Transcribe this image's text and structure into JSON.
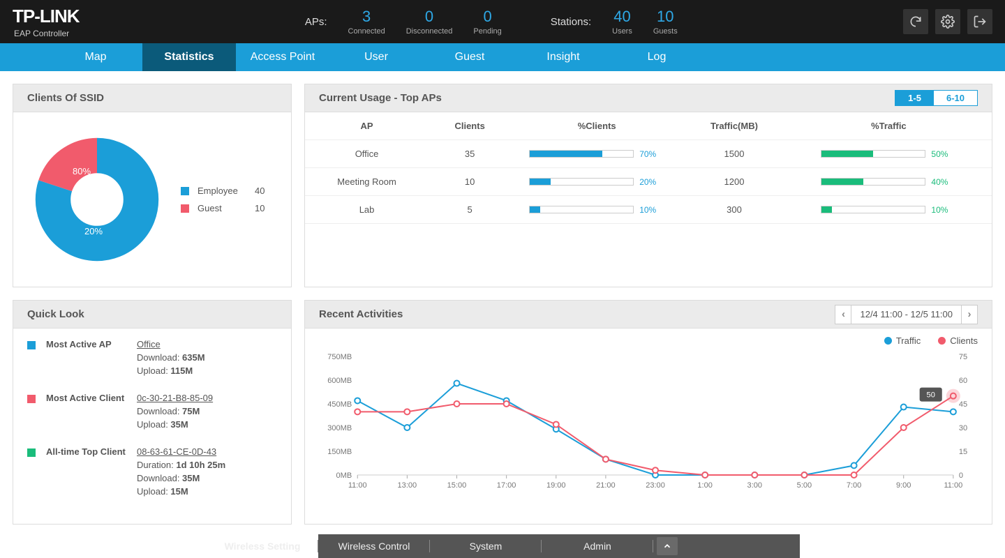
{
  "brand": {
    "name": "TP-LINK",
    "sub": "EAP Controller"
  },
  "header_stats": {
    "aps_label": "APs:",
    "aps": [
      {
        "n": "3",
        "c": "Connected"
      },
      {
        "n": "0",
        "c": "Disconnected"
      },
      {
        "n": "0",
        "c": "Pending"
      }
    ],
    "stations_label": "Stations:",
    "stations": [
      {
        "n": "40",
        "c": "Users"
      },
      {
        "n": "10",
        "c": "Guests"
      }
    ]
  },
  "nav": [
    "Map",
    "Statistics",
    "Access Point",
    "User",
    "Guest",
    "Insight",
    "Log"
  ],
  "clients_ssid": {
    "title": "Clients Of SSID",
    "legend": [
      {
        "name": "Employee",
        "val": "40",
        "color": "#1b9ed8"
      },
      {
        "name": "Guest",
        "val": "10",
        "color": "#f15b6c"
      }
    ],
    "pct80": "80%",
    "pct20": "20%"
  },
  "top_aps": {
    "title": "Current Usage - Top APs",
    "seg": [
      "1-5",
      "6-10"
    ],
    "cols": [
      "AP",
      "Clients",
      "%Clients",
      "Traffic(MB)",
      "%Traffic"
    ],
    "rows": [
      {
        "ap": "Office",
        "clients": "35",
        "pc": 70,
        "traffic": "1500",
        "pt": 50
      },
      {
        "ap": "Meeting Room",
        "clients": "10",
        "pc": 20,
        "traffic": "1200",
        "pt": 40
      },
      {
        "ap": "Lab",
        "clients": "5",
        "pc": 10,
        "traffic": "300",
        "pt": 10
      }
    ]
  },
  "quick": {
    "title": "Quick Look",
    "items": [
      {
        "color": "#1b9ed8",
        "name": "Most Active AP",
        "link": "Office",
        "lines": [
          "Download: 635M",
          "Upload: 115M"
        ]
      },
      {
        "color": "#f15b6c",
        "name": "Most Active Client",
        "link": "0c-30-21-B8-85-09",
        "lines": [
          "Download: 75M",
          "Upload: 35M"
        ]
      },
      {
        "color": "#1abc7b",
        "name": "All-time Top Client",
        "link": "08-63-61-CE-0D-43",
        "lines": [
          "Duration: 1d 10h 25m",
          "Download: 35M",
          "Upload: 15M"
        ]
      }
    ]
  },
  "recent": {
    "title": "Recent Activities",
    "range": "12/4 11:00 - 12/5 11:00",
    "legend": [
      {
        "name": "Traffic",
        "color": "#1b9ed8"
      },
      {
        "name": "Clients",
        "color": "#f15b6c"
      }
    ],
    "tooltip": "50"
  },
  "chart_data": {
    "type": "line",
    "x_ticks": [
      "11:00",
      "13:00",
      "15:00",
      "17:00",
      "19:00",
      "21:00",
      "23:00",
      "1:00",
      "3:00",
      "5:00",
      "7:00",
      "9:00",
      "11:00"
    ],
    "y_left_label": "MB",
    "y_left_ticks": [
      0,
      150,
      300,
      450,
      600,
      750
    ],
    "y_right_ticks": [
      0,
      15,
      30,
      45,
      60,
      75
    ],
    "series": [
      {
        "name": "Traffic",
        "axis": "left",
        "color": "#1b9ed8",
        "values": [
          470,
          300,
          580,
          470,
          290,
          100,
          0,
          0,
          0,
          0,
          60,
          430,
          400
        ]
      },
      {
        "name": "Clients",
        "axis": "right",
        "color": "#f15b6c",
        "values": [
          40,
          40,
          45,
          45,
          32,
          10,
          3,
          0,
          0,
          0,
          0,
          30,
          50
        ]
      }
    ]
  },
  "bottom_tabs": [
    "Wireless Setting",
    "Wireless Control",
    "System",
    "Admin"
  ]
}
